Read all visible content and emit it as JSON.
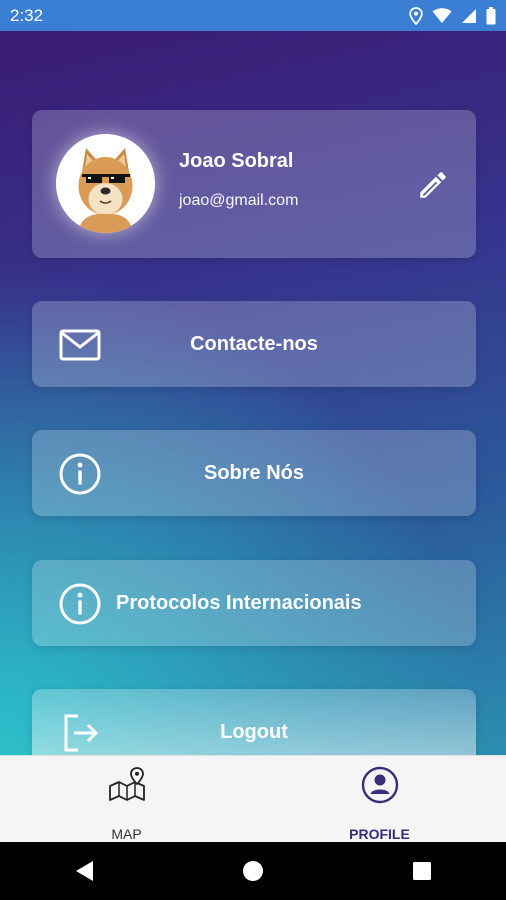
{
  "status_bar": {
    "time": "2:32"
  },
  "profile": {
    "name": "Joao Sobral",
    "email": "joao@gmail.com"
  },
  "menu": {
    "items": [
      {
        "label": "Contacte-nos",
        "icon": "mail-icon"
      },
      {
        "label": "Sobre Nós",
        "icon": "info-icon"
      },
      {
        "label": "Protocolos Internacionais",
        "icon": "info-icon"
      },
      {
        "label": "Logout",
        "icon": "logout-icon"
      }
    ]
  },
  "bottom_nav": {
    "items": [
      {
        "label": "MAP",
        "icon": "map-pin-icon",
        "active": false
      },
      {
        "label": "PROFILE",
        "icon": "profile-icon",
        "active": true
      }
    ]
  },
  "colors": {
    "status_bar": "#3b7fd4",
    "active_tab": "#3a2c78",
    "gradient_top": "#3b1b74",
    "gradient_bottom": "#2cc4cc"
  }
}
